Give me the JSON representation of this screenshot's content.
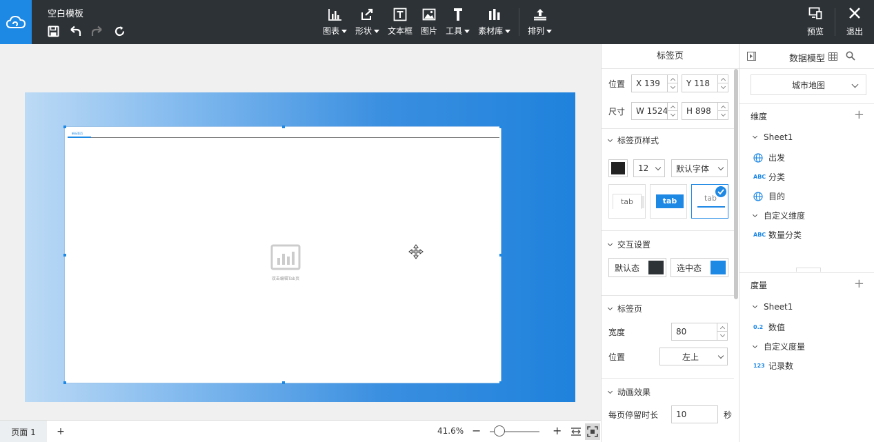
{
  "header": {
    "title": "空白模板",
    "tools": [
      {
        "label": "图表",
        "icon": "bar-chart-icon",
        "dropdown": true
      },
      {
        "label": "形状",
        "icon": "shape-icon",
        "dropdown": true
      },
      {
        "label": "文本框",
        "icon": "textbox-icon",
        "dropdown": false
      },
      {
        "label": "图片",
        "icon": "image-icon",
        "dropdown": false
      },
      {
        "label": "工具",
        "icon": "tool-icon",
        "dropdown": true
      },
      {
        "label": "素材库",
        "icon": "library-icon",
        "dropdown": true
      },
      {
        "label": "排列",
        "icon": "arrange-icon",
        "dropdown": true
      }
    ],
    "preview_label": "预览",
    "exit_label": "退出"
  },
  "canvas": {
    "placeholder_text": "双击编辑Tab页",
    "tab_name": "新标签页"
  },
  "footer": {
    "page_tab": "页面 1",
    "add_page": "+",
    "zoom": "41.6%",
    "zoom_level": 0.2
  },
  "props": {
    "title": "标签页",
    "position": {
      "label": "位置",
      "x": "X 139",
      "y": "Y 118"
    },
    "size": {
      "label": "尺寸",
      "w": "W 1524",
      "h": "H 898"
    },
    "tab_style": {
      "heading": "标签页样式",
      "color": "#222222",
      "font_size": "12",
      "font_family": "默认字体",
      "card_text": "tab"
    },
    "interaction": {
      "heading": "交互设置",
      "default_label": "默认态",
      "default_color": "#2d3236",
      "selected_label": "选中态",
      "selected_color": "#1e88e5"
    },
    "tab_page": {
      "heading": "标签页",
      "width_label": "宽度",
      "width_value": "80",
      "position_label": "位置",
      "position_value": "左上"
    },
    "animation": {
      "heading": "动画效果",
      "duration_label": "每页停留时长",
      "duration_value": "10",
      "unit": "秒"
    }
  },
  "data_model": {
    "title": "数据模型",
    "source": "城市地图",
    "dimension_heading": "维度",
    "dimensions": [
      {
        "label": "Sheet1",
        "type": "group"
      },
      {
        "label": "出发",
        "type": "geo"
      },
      {
        "label": "分类",
        "type": "text",
        "icon_text": "ABC"
      },
      {
        "label": "目的",
        "type": "geo"
      },
      {
        "label": "自定义维度",
        "type": "group"
      },
      {
        "label": "数量分类",
        "type": "text",
        "icon_text": "ABC"
      }
    ],
    "measure_heading": "度量",
    "measures": [
      {
        "label": "Sheet1",
        "type": "group"
      },
      {
        "label": "数值",
        "type": "num",
        "icon_text": "0.2"
      },
      {
        "label": "自定义度量",
        "type": "group"
      },
      {
        "label": "记录数",
        "type": "num",
        "icon_text": "123"
      }
    ]
  },
  "colors": {
    "accent": "#1e88e5",
    "topbar": "#2d3236"
  }
}
